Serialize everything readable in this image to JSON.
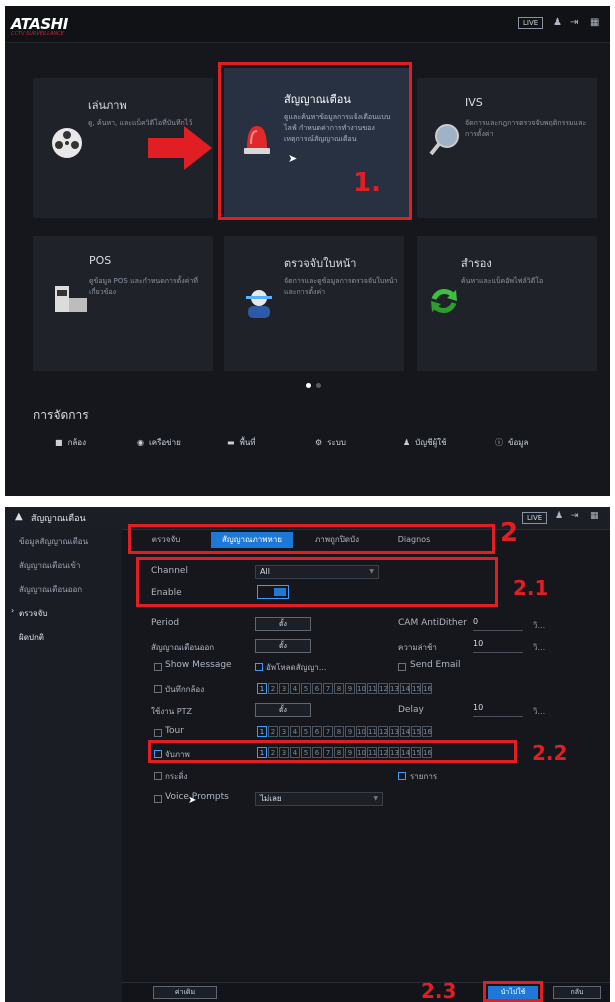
{
  "top": {
    "logo": "ATASHI",
    "logo_sub": "CCTV SURVEILLANCE",
    "live_label": "LIVE",
    "tiles": [
      {
        "title": "เล่นภาพ",
        "desc": "ดู, ค้นหา, และแบ็ควิดีโอที่บันทึกไว้"
      },
      {
        "title": "สัญญาณเตือน",
        "desc": "ดูและค้นหาข้อมูลการแจ้งเตือนแบบไลฟ์ กำหนดค่าการทำงานของเหตุการณ์สัญญาณเตือน"
      },
      {
        "title": "IVS",
        "desc": "จัดการและกฎการตรวจจับพฤติกรรมและการตั้งค่า"
      },
      {
        "title": "POS",
        "desc": "ดูข้อมูล POS และกำหนดการตั้งค่าที่เกี่ยวข้อง"
      },
      {
        "title": "ตรวจจับใบหน้า",
        "desc": "จัดการและดูข้อมูลการตรวจจับใบหน้าและการตั้งค่า"
      },
      {
        "title": "สำรอง",
        "desc": "ค้นหาและแบ็คอัพไฟล์วิดีโอ"
      }
    ],
    "callout_1": "1.",
    "management_title": "การจัดการ",
    "management_items": [
      "กล้อง",
      "เครือข่าย",
      "พื้นที่",
      "ระบบ",
      "บัญชีผู้ใช้",
      "ข้อมูล"
    ]
  },
  "bottom": {
    "header_title": "สัญญาณเตือน",
    "live_label": "LIVE",
    "sidebar": [
      "ข้อมูลสัญญาณเตือน",
      "สัญญาณเตือนเข้า",
      "สัญญาณเตือนออก",
      "ตรวจจับ",
      "ผิดปกติ"
    ],
    "tabs": [
      "ตรวจจับ",
      "สัญญาณภาพหาย",
      "ภาพถูกปิดบัง",
      "Diagnos"
    ],
    "callout_2": "2",
    "callout_2_1": "2.1",
    "callout_2_2": "2.2",
    "callout_2_3": "2.3",
    "channel_label": "Channel",
    "channel_value": "All",
    "enable_label": "Enable",
    "period_label": "Period",
    "setting_btn": "ตั้ง",
    "alarm_out_label": "สัญญาณเตือนออก",
    "cam_antidither_label": "CAM AntiDither",
    "cam_antidither_value": "0",
    "latch_label": "ความล่าช้า",
    "latch_value": "10",
    "unit_sec": "วิ...",
    "show_message": "Show Message",
    "upload_alarm": "อัพโหลดสัญญา...",
    "send_email": "Send Email",
    "record_channel": "บันทึกกล้อง",
    "ptz_label": "ใช้งาน PTZ",
    "delay_label": "Delay",
    "delay_value": "10",
    "tour_label": "Tour",
    "snapshot_label": "จับภาพ",
    "buzzer_label": "กระดิ่ง",
    "log_label": "รายการ",
    "voice_label": "Voice Prompts",
    "voice_value": "ไม่เลย",
    "default_btn": "ค่าเดิม",
    "apply_btn": "นำไปใช้",
    "back_btn": "กลับ",
    "channel_numbers": [
      "1",
      "2",
      "3",
      "4",
      "5",
      "6",
      "7",
      "8",
      "9",
      "10",
      "11",
      "12",
      "13",
      "14",
      "15",
      "16"
    ]
  },
  "colors": {
    "highlight_red": "#e01e24",
    "accent_blue": "#1e78d8",
    "panel_bg": "#15171c"
  }
}
